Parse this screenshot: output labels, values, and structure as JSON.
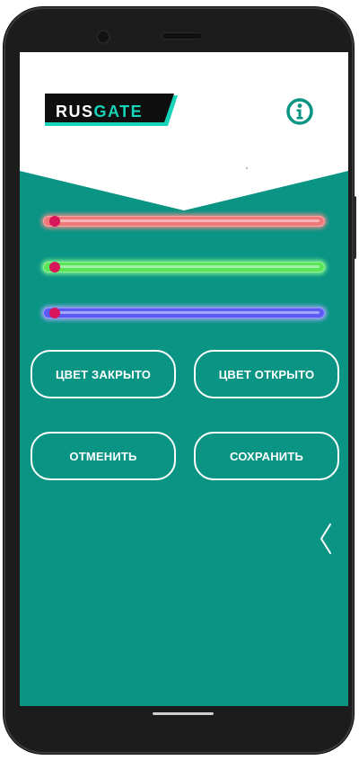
{
  "app": {
    "logo": {
      "part1": "RUS",
      "part2": "GATE"
    },
    "info_icon": "info-icon",
    "colors": {
      "background": "#0a9484",
      "header": "#ffffff",
      "red_slider": "#f07a7a",
      "green_slider": "#58e658",
      "blue_slider": "#5a5af5",
      "thumb": "#d8145a"
    }
  },
  "sliders": [
    {
      "color": "red",
      "value": 0
    },
    {
      "color": "green",
      "value": 0
    },
    {
      "color": "blue",
      "value": 0
    }
  ],
  "buttons": {
    "close_color": "ЦВЕТ ЗАКРЫТО",
    "open_color": "ЦВЕТ ОТКРЫТО",
    "cancel": "ОТМЕНИТЬ",
    "save": "СОХРАНИТЬ"
  },
  "drawer_handle_icon": "chevron-left-icon"
}
